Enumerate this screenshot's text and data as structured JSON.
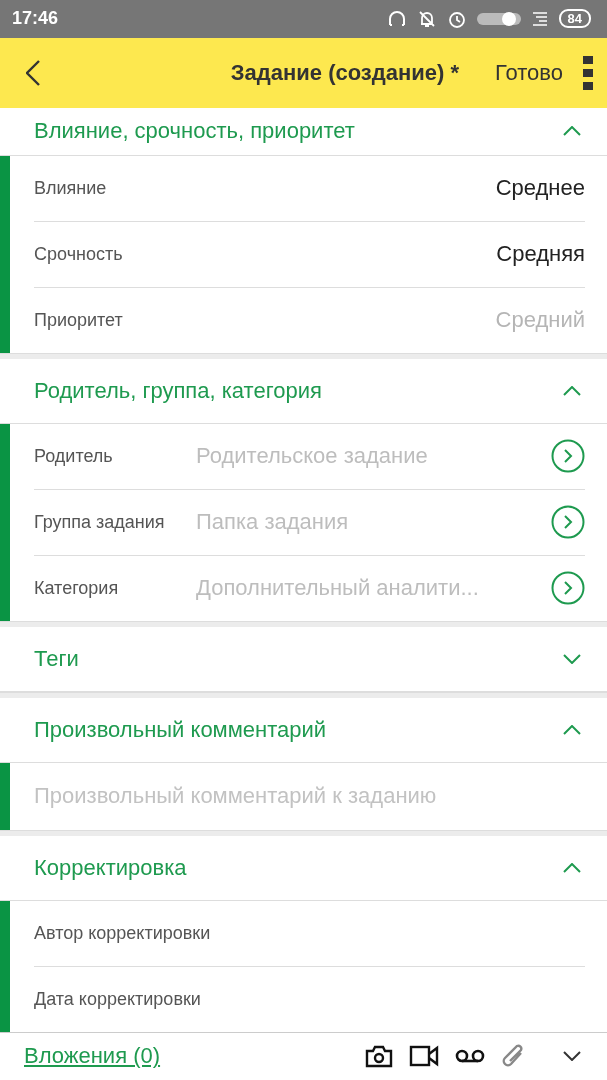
{
  "status_bar": {
    "time": "17:46",
    "battery": "84"
  },
  "app_bar": {
    "title": "Задание (создание) *",
    "action": "Готово"
  },
  "sections": [
    {
      "title": "Влияние, срочность, приоритет",
      "expanded": true,
      "rows": [
        {
          "kind": "choice",
          "label": "Влияние",
          "value": "Среднее"
        },
        {
          "kind": "choice",
          "label": "Срочность",
          "value": "Средняя"
        },
        {
          "kind": "choice",
          "label": "Приоритет",
          "placeholder": "Средний"
        }
      ]
    },
    {
      "title": "Родитель, группа, категория",
      "expanded": true,
      "rows": [
        {
          "kind": "link",
          "label": "Родитель",
          "placeholder": "Родительское задание"
        },
        {
          "kind": "link",
          "label": "Группа задания",
          "placeholder": "Папка задания"
        },
        {
          "kind": "link",
          "label": "Категория",
          "placeholder": "Дополнительный аналити..."
        }
      ]
    },
    {
      "title": "Теги",
      "expanded": false
    },
    {
      "title": "Произвольный комментарий",
      "expanded": true,
      "rows": [
        {
          "kind": "text",
          "placeholder": "Произвольный комментарий к заданию"
        }
      ]
    },
    {
      "title": "Корректировка",
      "expanded": true,
      "rows": [
        {
          "kind": "label",
          "label": "Автор корректировки"
        },
        {
          "kind": "label",
          "label": "Дата корректировки"
        }
      ]
    }
  ],
  "footer": {
    "link": "Вложения (0)"
  }
}
